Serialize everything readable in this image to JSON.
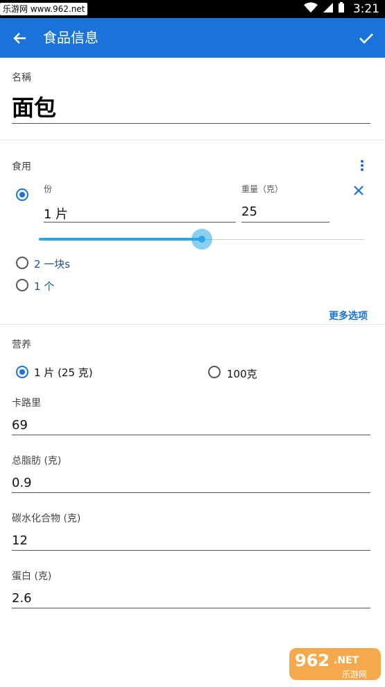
{
  "status_bar": {
    "watermark": "乐游网 www.962.net",
    "time": "3:21"
  },
  "app_bar": {
    "title": "食品信息"
  },
  "name_section": {
    "label": "名稱",
    "value": "面包"
  },
  "serving_section": {
    "label": "食用",
    "portion_label": "份",
    "weight_label": "重量（克）",
    "portion_value": "1 片",
    "weight_value": "25",
    "slider_fraction": 0.5,
    "options": [
      "2 一块s",
      "1 个"
    ],
    "more_options": "更多选项"
  },
  "nutrition_section": {
    "label": "营养",
    "basis_options": [
      "1 片 (25 克)",
      "100克"
    ],
    "fields": [
      {
        "label": "卡路里",
        "value": "69"
      },
      {
        "label": "总脂肪 (克)",
        "value": "0.9"
      },
      {
        "label": "碳水化合物 (克)",
        "value": "12"
      },
      {
        "label": "蛋白 (克)",
        "value": "2.6"
      }
    ]
  },
  "bottom_watermark": {
    "brand": "962",
    "suffix": ".NET",
    "subtitle": "乐游网"
  },
  "colors": {
    "primary": "#1a73d9",
    "slider": "#2aa7e8",
    "option_text": "#1a4f9a"
  },
  "icons": [
    "back-arrow-icon",
    "check-icon",
    "more-vert-icon",
    "close-icon",
    "wifi-icon",
    "signal-icon"
  ]
}
